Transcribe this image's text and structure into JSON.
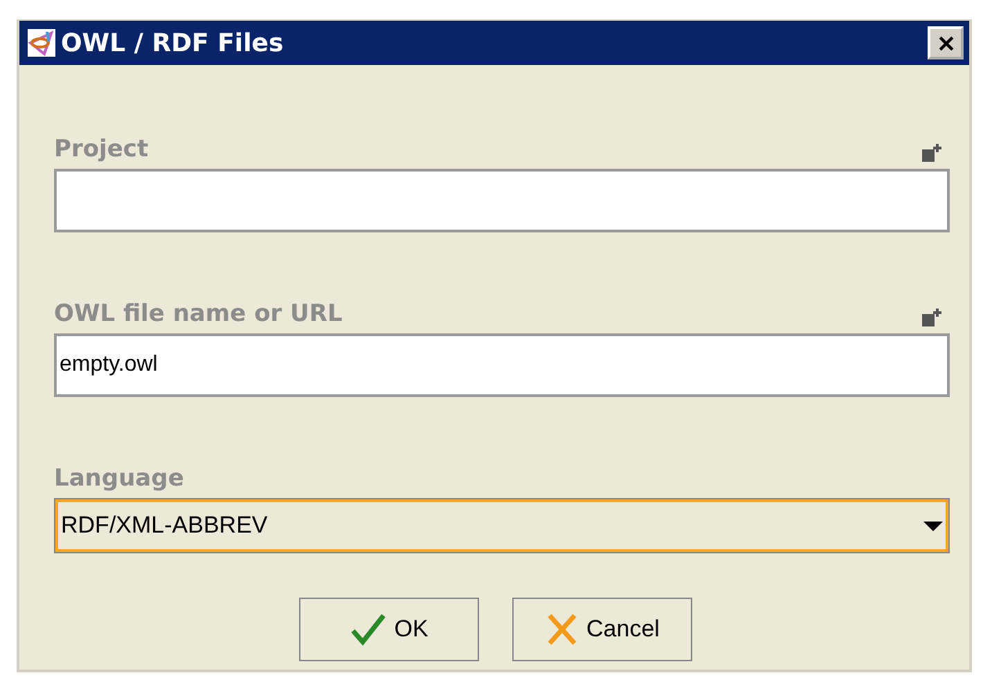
{
  "window": {
    "title": "OWL / RDF Files"
  },
  "fields": [
    {
      "kind": "text",
      "label": "Project",
      "add_button": true,
      "focused": false
    },
    {
      "kind": "text",
      "label": "OWL file name or URL",
      "value": "empty.owl",
      "add_button": true,
      "focused": false
    },
    {
      "kind": "combo",
      "label": "Language",
      "value": "RDF/XML-ABBREV",
      "focused": true
    }
  ],
  "buttons": [
    {
      "kind": "ok",
      "label": "OK"
    },
    {
      "kind": "cancel",
      "label": "Cancel"
    }
  ]
}
